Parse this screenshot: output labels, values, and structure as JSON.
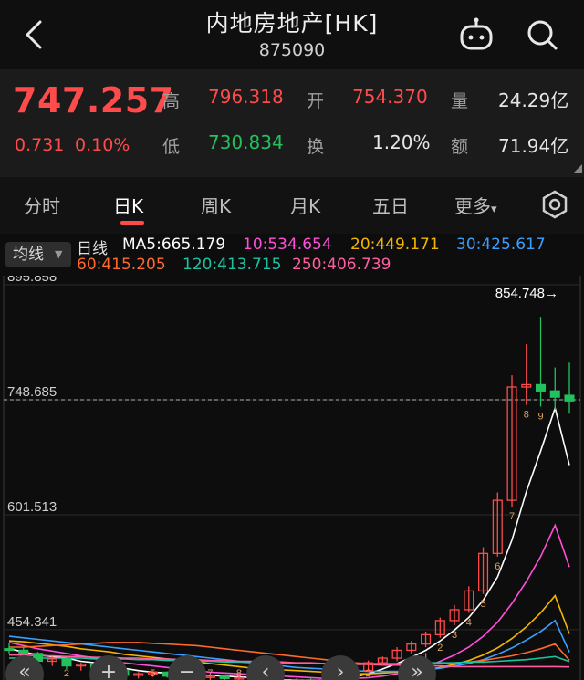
{
  "header": {
    "title": "内地房地产[HK]",
    "code": "875090"
  },
  "quote": {
    "price": "747.257",
    "change": "0.731",
    "change_pct": "0.10%",
    "fields": {
      "high_label": "高",
      "high_value": "796.318",
      "open_label": "开",
      "open_value": "754.370",
      "volume_label": "量",
      "volume_value": "24.29亿",
      "low_label": "低",
      "low_value": "730.834",
      "turnover_rate_label": "换",
      "turnover_rate_value": "1.20%",
      "amount_label": "额",
      "amount_value": "71.94亿"
    }
  },
  "tabs": [
    "分时",
    "日K",
    "周K",
    "月K",
    "五日",
    "更多"
  ],
  "tabs_more_arrow": "▾",
  "active_tab": "日K",
  "ma_legend": {
    "selector": "均线",
    "period_label": "日线",
    "ma5": "MA5:665.179",
    "ma10": "10:534.654",
    "ma20": "20:449.171",
    "ma30": "30:425.617",
    "ma60": "60:415.205",
    "ma120": "120:413.715",
    "ma250": "250:406.739"
  },
  "colors": {
    "up": "#ff4b4b",
    "down": "#22c15e",
    "ma5": "#ffffff",
    "ma10": "#ff4fd8",
    "ma20": "#f5b400",
    "ma30": "#3aa0ff",
    "ma60": "#ff6a2c",
    "ma120": "#19c3a4",
    "ma250": "#ff5fa0"
  },
  "chart_data": {
    "type": "candlestick",
    "y_ticks": [
      "895.858",
      "748.685",
      "601.513",
      "454.341"
    ],
    "max_annotation": "854.748→",
    "current_line": 748.685,
    "ylim": [
      390,
      895.858
    ],
    "candles": [
      [
        430,
        438,
        424,
        428
      ],
      [
        428,
        432,
        420,
        424
      ],
      [
        424,
        426,
        410,
        414
      ],
      [
        414,
        420,
        408,
        417
      ],
      [
        417,
        418,
        404,
        408
      ],
      [
        408,
        412,
        402,
        410
      ],
      [
        410,
        412,
        400,
        404
      ],
      [
        404,
        406,
        398,
        402
      ],
      [
        402,
        404,
        394,
        396
      ],
      [
        396,
        400,
        392,
        398
      ],
      [
        398,
        402,
        394,
        400
      ],
      [
        400,
        401,
        393,
        395
      ],
      [
        395,
        398,
        390,
        396
      ],
      [
        396,
        398,
        391,
        394
      ],
      [
        394,
        397,
        390,
        395
      ],
      [
        395,
        396,
        389,
        392
      ],
      [
        392,
        395,
        388,
        393
      ],
      [
        393,
        394,
        387,
        390
      ],
      [
        390,
        392,
        385,
        386
      ],
      [
        386,
        390,
        384,
        389
      ],
      [
        389,
        392,
        386,
        390
      ],
      [
        390,
        393,
        387,
        388
      ],
      [
        388,
        391,
        385,
        390
      ],
      [
        390,
        398,
        388,
        396
      ],
      [
        396,
        404,
        394,
        402
      ],
      [
        402,
        415,
        400,
        412
      ],
      [
        412,
        420,
        408,
        418
      ],
      [
        418,
        432,
        414,
        428
      ],
      [
        428,
        440,
        424,
        436
      ],
      [
        436,
        452,
        432,
        448
      ],
      [
        448,
        470,
        444,
        466
      ],
      [
        466,
        486,
        460,
        480
      ],
      [
        480,
        510,
        476,
        504
      ],
      [
        504,
        560,
        500,
        552
      ],
      [
        552,
        630,
        548,
        620
      ],
      [
        620,
        780,
        612,
        765
      ],
      [
        765,
        820,
        742,
        768
      ],
      [
        768,
        854.748,
        740,
        760
      ],
      [
        760,
        790,
        736,
        752
      ],
      [
        754.37,
        796.318,
        730.834,
        747.257
      ]
    ],
    "series": [
      {
        "name": "MA5",
        "values": [
          430,
          426,
          422,
          420,
          418,
          414,
          412,
          408,
          405,
          402,
          400,
          399,
          398,
          397,
          396,
          395,
          394,
          393,
          392,
          390,
          390,
          389,
          390,
          391,
          394,
          398,
          404,
          411,
          419,
          428,
          440,
          454,
          470,
          492,
          522,
          569,
          631,
          683,
          738,
          665.179
        ]
      },
      {
        "name": "10",
        "values": [
          438,
          434,
          430,
          427,
          424,
          421,
          418,
          415,
          412,
          410,
          408,
          406,
          404,
          402,
          400,
          399,
          398,
          397,
          396,
          395,
          394,
          393,
          392,
          392,
          392,
          393,
          395,
          398,
          402,
          407,
          414,
          422,
          432,
          446,
          464,
          488,
          516,
          548,
          588,
          534.654
        ]
      },
      {
        "name": "20",
        "values": [
          440,
          439,
          437,
          435,
          433,
          430,
          428,
          426,
          423,
          421,
          419,
          417,
          415,
          413,
          411,
          409,
          407,
          405,
          404,
          403,
          402,
          401,
          400,
          399,
          398,
          398,
          399,
          400,
          401,
          403,
          406,
          410,
          415,
          422,
          431,
          443,
          458,
          476,
          498,
          449.171
        ]
      },
      {
        "name": "30",
        "values": [
          446,
          444,
          442,
          440,
          438,
          436,
          434,
          432,
          430,
          428,
          426,
          424,
          422,
          420,
          418,
          416,
          414,
          412,
          410,
          408,
          406,
          405,
          404,
          403,
          402,
          401,
          401,
          401,
          402,
          403,
          405,
          408,
          411,
          416,
          423,
          431,
          441,
          452,
          466,
          425.617
        ]
      },
      {
        "name": "60",
        "values": [
          432,
          432,
          433,
          434,
          435,
          436,
          437,
          438,
          438,
          438,
          437,
          436,
          435,
          434,
          432,
          430,
          428,
          426,
          424,
          422,
          420,
          418,
          416,
          414,
          412,
          411,
          410,
          410,
          410,
          410,
          411,
          412,
          413,
          415,
          418,
          421,
          425,
          430,
          436,
          415.205
        ]
      },
      {
        "name": "120",
        "values": [
          418,
          418,
          418,
          418,
          418,
          418,
          417,
          417,
          417,
          416,
          416,
          415,
          415,
          414,
          414,
          413,
          413,
          412,
          412,
          412,
          411,
          411,
          411,
          411,
          411,
          411,
          411,
          411,
          411,
          412,
          412,
          412,
          413,
          413,
          414,
          415,
          416,
          418,
          420,
          413.715
        ]
      },
      {
        "name": "250",
        "values": [
          422,
          422,
          421,
          421,
          420,
          420,
          419,
          419,
          418,
          418,
          417,
          417,
          416,
          416,
          415,
          415,
          414,
          414,
          413,
          413,
          412,
          412,
          411,
          411,
          410,
          410,
          409,
          409,
          408,
          408,
          408,
          407,
          407,
          407,
          407,
          407,
          407,
          407,
          407,
          406.739
        ]
      }
    ],
    "markers": [
      "1",
      "2",
      "3",
      "4",
      "5",
      "6",
      "7",
      "8",
      "1",
      "2",
      "1",
      "2",
      "3",
      "4",
      "5",
      "6",
      "7",
      "8",
      "9"
    ]
  },
  "controls": [
    "«",
    "+",
    "−",
    "‹",
    "›",
    "»"
  ]
}
